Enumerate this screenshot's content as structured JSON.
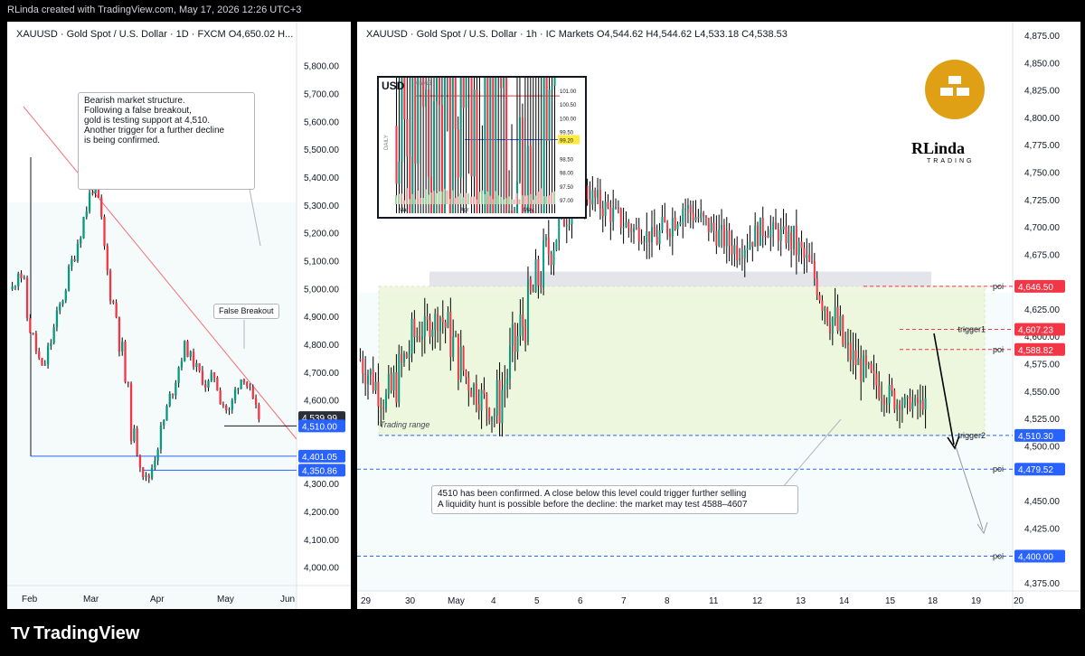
{
  "header": {
    "credit": "RLinda created with TradingView.com, May 17, 2026 12:26 UTC+3"
  },
  "footer": {
    "brand": "TradingView"
  },
  "left_panel": {
    "title": "XAUUSD · Gold Spot / U.S. Dollar · 1D · FXCM  O4,650.02  H...",
    "note": [
      "Bearish market structure.",
      "Following a false breakout,",
      "gold is testing support at 4,510.",
      "Another trigger for a further decline",
      "is being confirmed."
    ],
    "false_breakout_label": "False Breakout",
    "price_axis": [
      "5,800.00",
      "5,700.00",
      "5,600.00",
      "5,500.00",
      "5,400.00",
      "5,300.00",
      "5,200.00",
      "5,100.00",
      "5,000.00",
      "4,900.00",
      "4,800.00",
      "4,700.00",
      "4,600.00",
      "4,300.00",
      "4,200.00",
      "4,100.00",
      "4,000.00"
    ],
    "tags": [
      {
        "label": "4,539.99",
        "color": "#2a2e39"
      },
      {
        "label": "4,510.00",
        "color": "#2962ff"
      },
      {
        "label": "4,401.05",
        "color": "#2962ff"
      },
      {
        "label": "4,350.86",
        "color": "#2962ff"
      }
    ],
    "time_axis": [
      "Feb",
      "Mar",
      "Apr",
      "May",
      "Jun"
    ]
  },
  "right_panel": {
    "title": "XAUUSD · Gold Spot / U.S. Dollar · 1h · IC Markets  O4,544.62  H4,544.62  L4,533.18  C4,538.53",
    "inset": {
      "symbol": "USD",
      "month": "May15",
      "x_labels": [
        "Mar",
        "Apr",
        "May"
      ],
      "y_labels": [
        "101.00",
        "100.50",
        "100.00",
        "99.50",
        "99.20",
        "98.50",
        "98.00",
        "97.50",
        "97.00"
      ],
      "side_label": "DAILY"
    },
    "brand_name": "RLinda",
    "brand_sub": "TRADING",
    "trading_range_label": "Trading range",
    "note": [
      "4510 has been confirmed. A close below this level could trigger further selling",
      "A liquidity hunt is possible before the decline: the market may test 4588–4607"
    ],
    "level_labels": [
      "poi",
      "trigger1",
      "poi",
      "trigger2",
      "poi",
      "poi"
    ],
    "price_axis": [
      "4,875.00",
      "4,850.00",
      "4,825.00",
      "4,800.00",
      "4,775.00",
      "4,750.00",
      "4,725.00",
      "4,700.00",
      "4,675.00",
      "4,625.00",
      "4,600.00",
      "4,575.00",
      "4,550.00",
      "4,525.00",
      "4,500.00",
      "4,450.00",
      "4,425.00",
      "4,375.00"
    ],
    "tags": [
      {
        "label": "4,646.50",
        "color": "#f23645"
      },
      {
        "label": "4,607.23",
        "color": "#f23645"
      },
      {
        "label": "4,588.82",
        "color": "#f23645"
      },
      {
        "label": "4,510.30",
        "color": "#2962ff"
      },
      {
        "label": "4,479.52",
        "color": "#2962ff"
      },
      {
        "label": "4,400.00",
        "color": "#2962ff"
      }
    ],
    "time_axis": [
      "29",
      "30",
      "May",
      "4",
      "5",
      "6",
      "7",
      "8",
      "11",
      "12",
      "13",
      "14",
      "15",
      "18",
      "19",
      "20"
    ]
  },
  "chart_data": [
    {
      "type": "candlestick",
      "title": "XAUUSD · Gold Spot / U.S. Dollar · 1D · FXCM",
      "ylim": [
        3950,
        5870
      ],
      "x": [
        "Feb",
        "Mar",
        "Apr",
        "May",
        "Jun"
      ],
      "series": [
        {
          "values": [
            5000,
            5100,
            4900,
            4800,
            4700,
            4800,
            4900,
            5000,
            5100,
            5200,
            5300,
            5400,
            5200,
            5000,
            4900,
            4700,
            4500,
            4400,
            4300,
            4400,
            4500,
            4600,
            4700,
            4800,
            4750,
            4700,
            4650,
            4700,
            4600,
            4550,
            4650,
            4700,
            4600,
            4540
          ]
        }
      ],
      "levels": [
        4510.0,
        4401.05,
        4350.86
      ],
      "annotations": [
        "False Breakout",
        "Bearish market structure."
      ]
    },
    {
      "type": "candlestick",
      "title": "XAUUSD · Gold Spot / U.S. Dollar · 1h · IC Markets",
      "ylim": [
        4360,
        4880
      ],
      "x": [
        "29",
        "30",
        "May",
        "4",
        "5",
        "6",
        "7",
        "8",
        "11",
        "12",
        "13",
        "14",
        "15",
        "18",
        "19",
        "20"
      ],
      "series": [
        {
          "values": [
            4580,
            4540,
            4600,
            4620,
            4560,
            4530,
            4610,
            4680,
            4740,
            4720,
            4700,
            4690,
            4720,
            4700,
            4680,
            4700,
            4690,
            4650,
            4590,
            4560,
            4540,
            4539
          ]
        }
      ],
      "levels": [
        4646.5,
        4607.23,
        4588.82,
        4510.3,
        4479.52,
        4400.0
      ],
      "annotations": [
        "Trading range",
        "4510 has been confirmed."
      ]
    }
  ]
}
